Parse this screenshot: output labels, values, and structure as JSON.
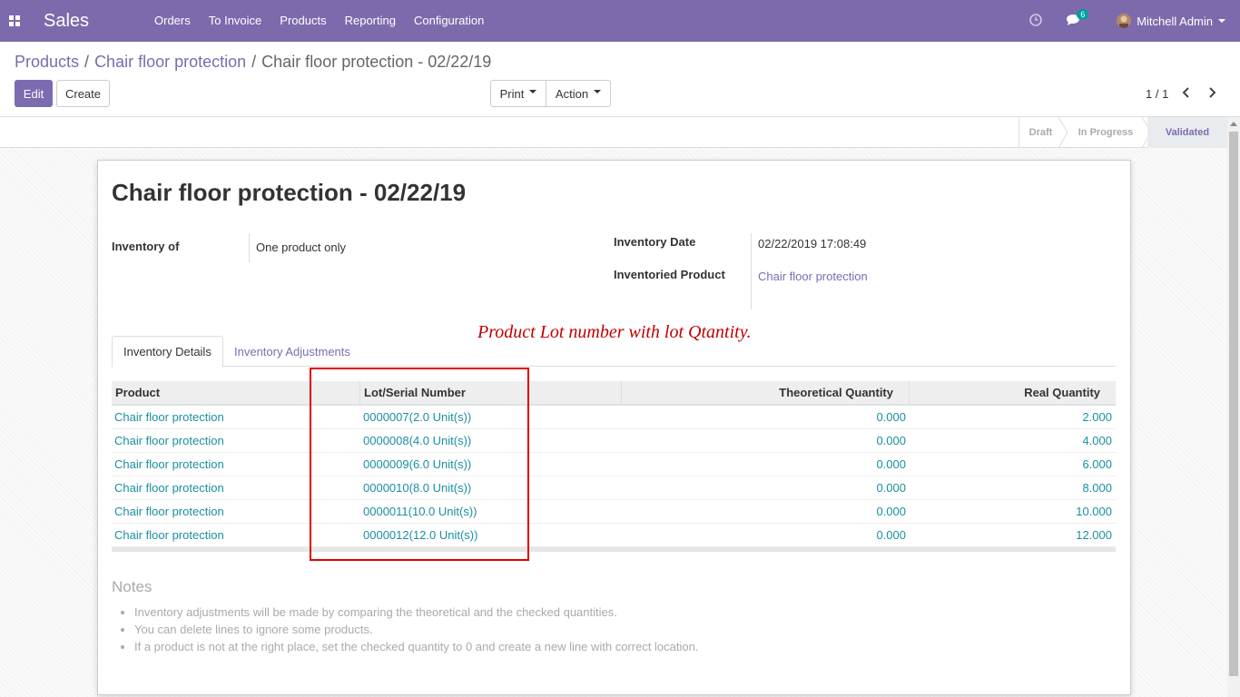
{
  "navbar": {
    "app_name": "Sales",
    "menu": [
      "Orders",
      "To Invoice",
      "Products",
      "Reporting",
      "Configuration"
    ],
    "messages_count": "6",
    "user_name": "Mitchell Admin"
  },
  "breadcrumb": {
    "items": [
      "Products",
      "Chair floor protection"
    ],
    "current": "Chair floor protection - 02/22/19"
  },
  "toolbar": {
    "edit_label": "Edit",
    "create_label": "Create",
    "print_label": "Print",
    "action_label": "Action",
    "pager": "1 / 1"
  },
  "statusbar": {
    "stages": [
      "Draft",
      "In Progress",
      "Validated"
    ],
    "active": "Validated"
  },
  "form": {
    "title": "Chair floor protection - 02/22/19",
    "inventory_of_label": "Inventory of",
    "inventory_of_value": "One product only",
    "inventory_date_label": "Inventory Date",
    "inventory_date_value": "02/22/2019 17:08:49",
    "inventoried_product_label": "Inventoried Product",
    "inventoried_product_value": "Chair floor protection",
    "annotation": "Product  Lot number with lot Qtantity."
  },
  "tabs": [
    "Inventory Details",
    "Inventory Adjustments"
  ],
  "table": {
    "headers": [
      "Product",
      "Lot/Serial Number",
      "Theoretical Quantity",
      "Real Quantity"
    ],
    "rows": [
      [
        "Chair floor protection",
        "0000007(2.0 Unit(s))",
        "0.000",
        "2.000"
      ],
      [
        "Chair floor protection",
        "0000008(4.0 Unit(s))",
        "0.000",
        "4.000"
      ],
      [
        "Chair floor protection",
        "0000009(6.0 Unit(s))",
        "0.000",
        "6.000"
      ],
      [
        "Chair floor protection",
        "0000010(8.0 Unit(s))",
        "0.000",
        "8.000"
      ],
      [
        "Chair floor protection",
        "0000011(10.0 Unit(s))",
        "0.000",
        "10.000"
      ],
      [
        "Chair floor protection",
        "0000012(12.0 Unit(s))",
        "0.000",
        "12.000"
      ]
    ]
  },
  "notes": {
    "title": "Notes",
    "items": [
      "Inventory adjustments will be made by comparing the theoretical and the checked quantities.",
      "You can delete lines to ignore some products.",
      "If a product is not at the right place, set the checked quantity to 0 and create a new line with correct location."
    ]
  },
  "colors": {
    "brand": "#7c6bb0",
    "link": "#1a8fa0",
    "annotation": "#c00000"
  }
}
